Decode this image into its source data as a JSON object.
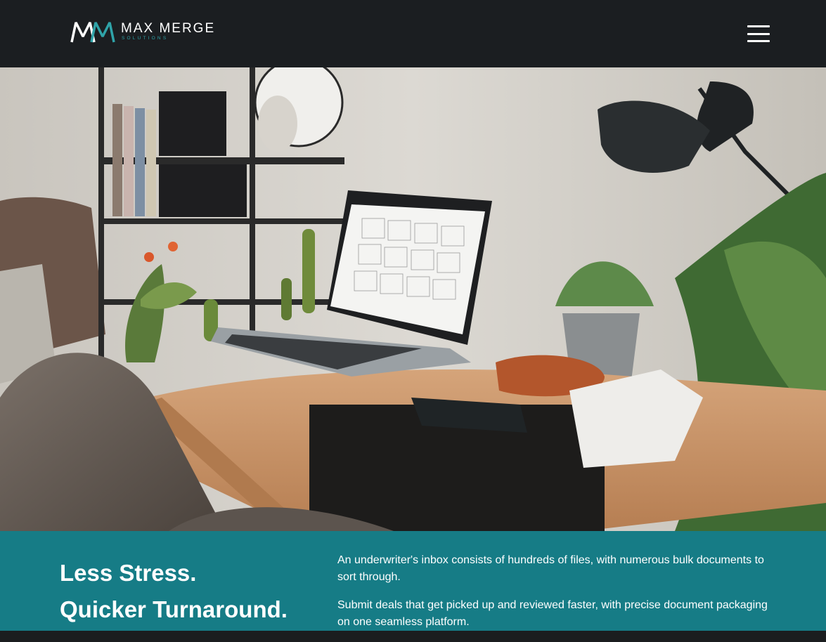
{
  "header": {
    "logo_name": "MAX MERGE",
    "logo_sub": "SOLUTIONS",
    "menu_icon": "hamburger-menu-icon"
  },
  "hero": {
    "image": "laptop-on-desk-photo"
  },
  "intro": {
    "headline_line1": "Less Stress.",
    "headline_line2": "Quicker Turnaround.",
    "paragraph1": "An underwriter's inbox consists of hundreds of files, with numerous bulk documents to sort through.",
    "paragraph2": "Submit deals that get picked up and reviewed faster, with precise document packaging on one seamless platform."
  },
  "colors": {
    "navbar_bg": "#1b1e21",
    "brand_teal": "#167c86",
    "logo_accent": "#2fa3a8",
    "text_white": "#ffffff"
  }
}
